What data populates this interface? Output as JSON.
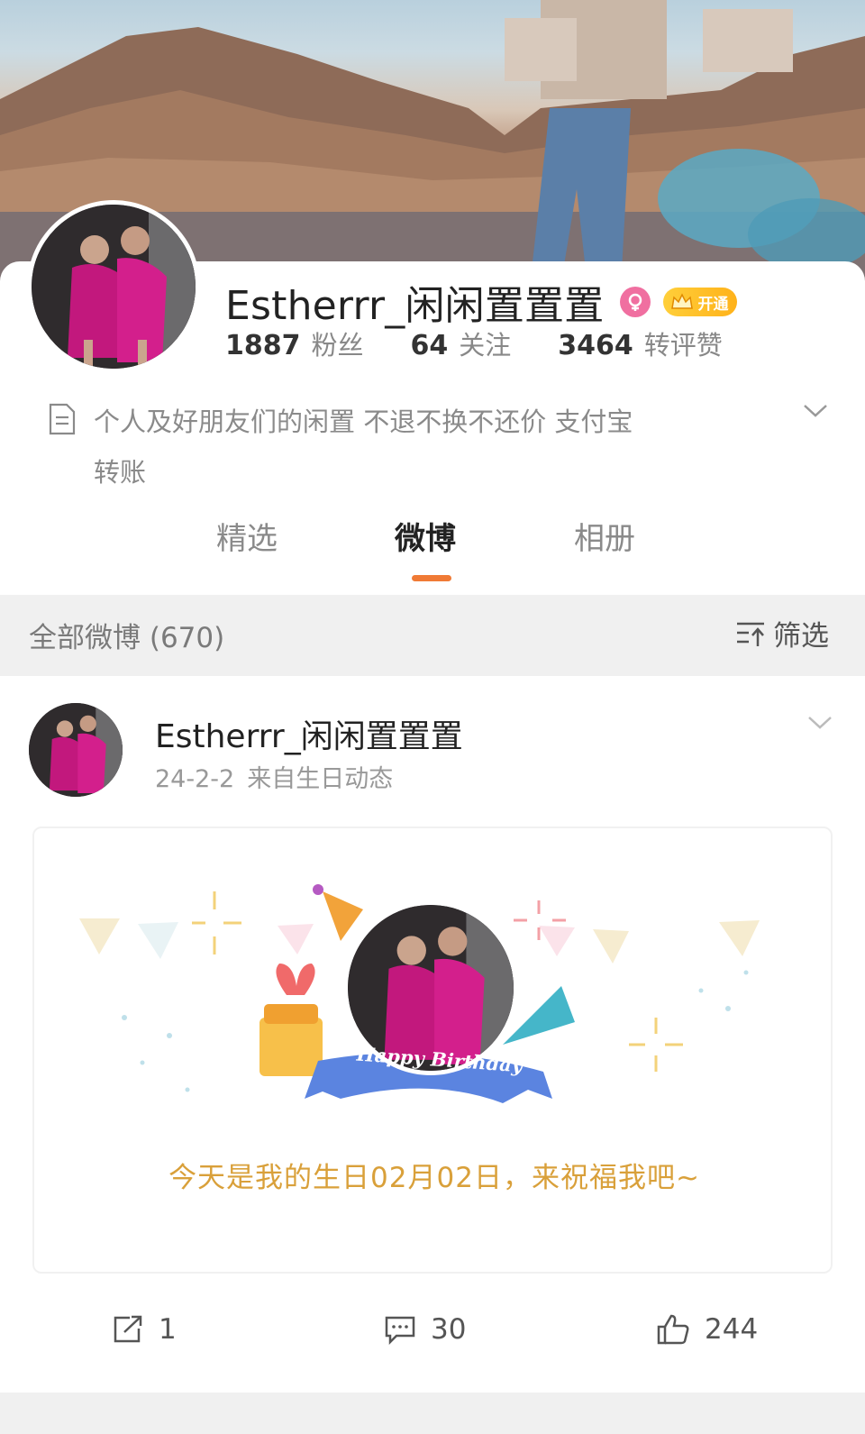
{
  "profile": {
    "name": "Estherrr_闲闲置置置",
    "vip_label": "开通",
    "stats": [
      {
        "num": "1887",
        "label": "粉丝"
      },
      {
        "num": "64",
        "label": "关注"
      },
      {
        "num": "3464",
        "label": "转评赞"
      }
    ],
    "bio_line1": "个人及好朋友们的闲置 不退不换不还价 支付宝",
    "bio_line2": "转账"
  },
  "tabs": [
    {
      "label": "精选",
      "active": false
    },
    {
      "label": "微博",
      "active": true
    },
    {
      "label": "相册",
      "active": false
    }
  ],
  "filter": {
    "count_label": "全部微博 (670)",
    "filter_label": "筛选"
  },
  "post": {
    "author": "Estherrr_闲闲置置置",
    "date": "24-2-2",
    "source": "来自生日动态",
    "card": {
      "ribbon_text": "Happy Birthday",
      "message": "今天是我的生日02月02日，来祝福我吧~"
    },
    "actions": {
      "reposts": "1",
      "comments": "30",
      "likes": "244"
    }
  },
  "colors": {
    "accent": "#f07a35",
    "vip": "#ffb21a",
    "gender": "#f06fa0",
    "birthday_text": "#d9a03a"
  },
  "icons": [
    "document-icon",
    "chevron-down-icon",
    "filter-icon",
    "repost-icon",
    "comment-icon",
    "like-icon",
    "female-icon",
    "crown-icon"
  ]
}
